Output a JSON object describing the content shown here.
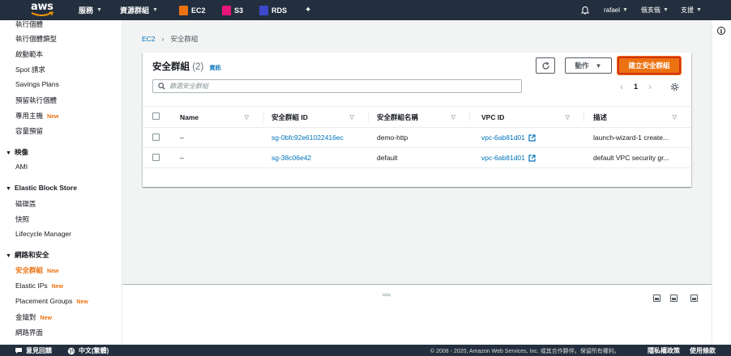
{
  "topnav": {
    "logo_text": "aws",
    "services": "服務",
    "resource_groups": "資源群組",
    "ec2": "EC2",
    "s3": "S3",
    "rds": "RDS",
    "user": "rafael",
    "region": "俄亥俄",
    "support": "支援",
    "colors": {
      "bg": "#232f3e",
      "ec2": "#ec7211",
      "s3": "#e7157b",
      "rds": "#3b48cc"
    }
  },
  "sidebar": {
    "items_top": [
      "執行個體",
      "執行個體類型",
      "啟動範本",
      "Spot 請求",
      "Savings Plans",
      "預留執行個體",
      "專用主機",
      "容量預留"
    ],
    "new_label": "New",
    "images_header": "映像",
    "ami": "AMI",
    "ebs_header": "Elastic Block Store",
    "volumes": "磁碟區",
    "snapshots": "快照",
    "lifecycle": "Lifecycle Manager",
    "network_header": "網路和安全",
    "security_groups": "安全群組",
    "elastic_ips": "Elastic IPs",
    "placement_groups": "Placement Groups",
    "key_pairs": "金鑰對",
    "network_interfaces": "網路界面"
  },
  "breadcrumb": {
    "root": "EC2",
    "current": "安全群組"
  },
  "panel": {
    "title": "安全群組",
    "count": "(2)",
    "info": "資訊",
    "actions_button": "動作",
    "create_button": "建立安全群組",
    "search_placeholder": "篩選安全群組",
    "page_number": "1"
  },
  "table": {
    "headers": [
      "Name",
      "安全群組 ID",
      "安全群組名稱",
      "VPC ID",
      "描述"
    ],
    "rows": [
      {
        "name": "–",
        "id": "sg-0bfc92e61022416ec",
        "group_name": "demo-http",
        "vpc": "vpc-6ab81d01",
        "description": "launch-wizard-1 create..."
      },
      {
        "name": "–",
        "id": "sg-38c06e42",
        "group_name": "default",
        "vpc": "vpc-6ab81d01",
        "description": "default VPC security gr..."
      }
    ]
  },
  "footer": {
    "feedback": "意見回饋",
    "language": "中文(繁體)",
    "copyright": "© 2008 - 2020, Amazon Web Services, Inc. 或其合作夥伴。保留所有權利。",
    "privacy": "隱私權政策",
    "terms": "使用條款"
  }
}
